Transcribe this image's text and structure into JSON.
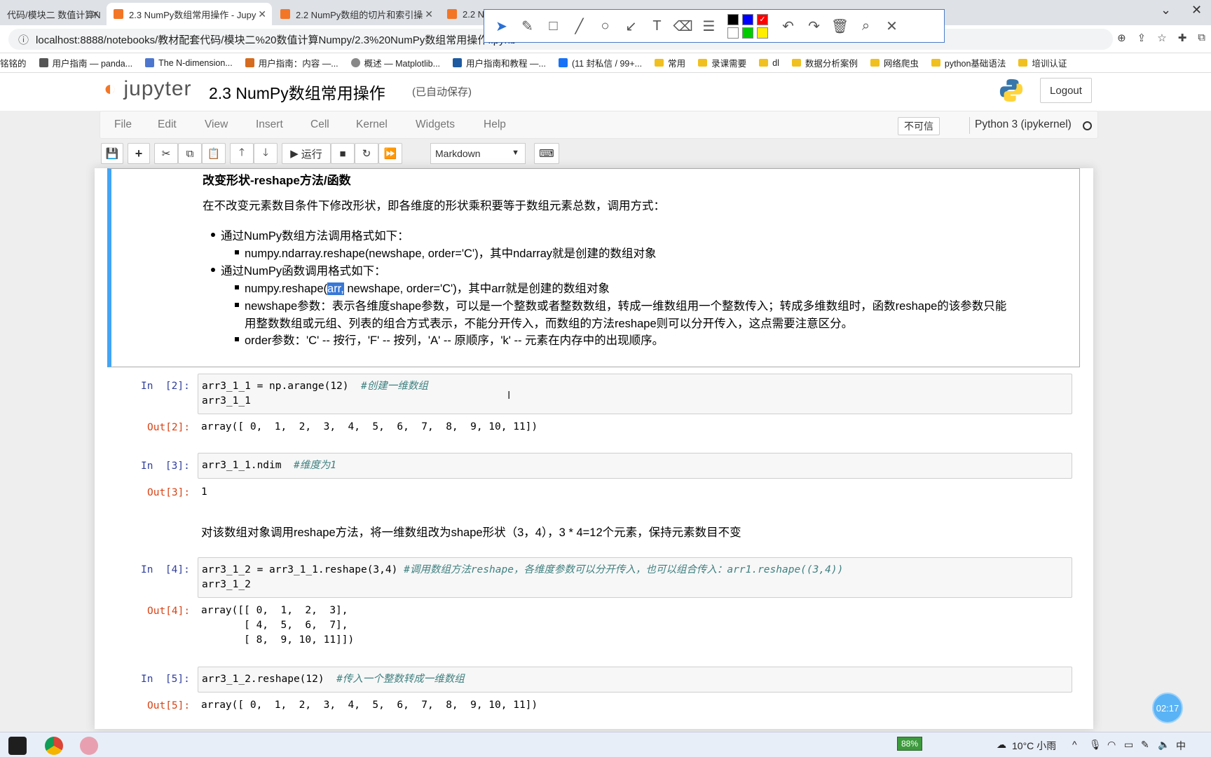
{
  "browser": {
    "tabs": [
      {
        "label": "代码/模块二 数值计算N"
      },
      {
        "label": "2.3 NumPy数组常用操作 - Jupy"
      },
      {
        "label": "2.2 NumPy数组的切片和索引操"
      },
      {
        "label": "2.2 N"
      }
    ],
    "url": "localhost:8888/notebooks/教材配套代码/模块二%20数值计算Numpy/2.3%20NumPy数组常用操作.ipynb",
    "bookmarks": [
      "铭铭的",
      "用户指南 — panda...",
      "The N-dimension...",
      "用户指南：内容 —...",
      "概述 — Matplotlib...",
      "用户指南和教程 —...",
      "(11 封私信 / 99+...",
      "常用",
      "录课需要",
      "dl",
      "数据分析案例",
      "网络爬虫",
      "python基础语法",
      "培训认证"
    ]
  },
  "draw_toolbar": {
    "tools": [
      "pointer-icon",
      "pen-icon",
      "rectangle-icon",
      "line-icon",
      "circle-icon",
      "arrow-icon",
      "text-icon",
      "eraser-icon",
      "stroke-width-icon",
      "undo-icon",
      "redo-icon",
      "trash-icon",
      "zoom-icon",
      "close-icon"
    ],
    "colors": [
      "#000000",
      "#0000ff",
      "#ff0000",
      "#ffffff",
      "#00cc00",
      "#ffee00"
    ]
  },
  "jupyter": {
    "logo_text": "jupyter",
    "notebook_title": "2.3 NumPy数组常用操作",
    "autosave": "(已自动保存)",
    "logout": "Logout",
    "menu": [
      "File",
      "Edit",
      "View",
      "Insert",
      "Cell",
      "Kernel",
      "Widgets",
      "Help"
    ],
    "trust": "不可信",
    "kernel": "Python 3 (ipykernel)",
    "run_label": "运行",
    "cell_type": "Markdown"
  },
  "markdown": {
    "heading": "改变形状-reshape方法/函数",
    "intro": "在不改变元素数目条件下修改形状，即各维度的形状乘积要等于数组元素总数，调用方式：",
    "b1": "通过NumPy数组方法调用格式如下：",
    "b1_1": "numpy.ndarray.reshape(newshape, order='C')，其中ndarray就是创建的数组对象",
    "b2": "通过NumPy函数调用格式如下：",
    "b2_1_pre": "numpy.reshape(",
    "b2_1_hl": "arr,",
    "b2_1_post": " newshape, order='C')，其中arr就是创建的数组对象",
    "b2_2_line1": "newshape参数：表示各维度shape参数，可以是一个整数或者整数数组，转成一维数组用一个整数传入；转成多维数组时，函数reshape的该参数只能",
    "b2_2_line2": "用整数数组或元组、列表的组合方式表示，不能分开传入，而数组的方法reshape则可以分开传入，这点需要注意区分。",
    "b2_3": "order参数：'C' -- 按行，'F' -- 按列，'A' -- 原顺序，'k' -- 元素在内存中的出现顺序。"
  },
  "cells": {
    "c2_in": "In  [2]:",
    "c2_l1": "arr3_1_1 = np.arange(12)",
    "c2_cm": "#创建一维数组",
    "c2_l2": "arr3_1_1",
    "c2_out_p": "Out[2]:",
    "c2_out": "array([ 0,  1,  2,  3,  4,  5,  6,  7,  8,  9, 10, 11])",
    "c3_in": "In  [3]:",
    "c3_l1": "arr3_1_1.ndim",
    "c3_cm": "#维度为1",
    "c3_out_p": "Out[3]:",
    "c3_out": "1",
    "md2": "对该数组对象调用reshape方法，将一维数组改为shape形状（3，4），3 * 4=12个元素，保持元素数目不变",
    "c4_in": "In  [4]:",
    "c4_l1": "arr3_1_2 = arr3_1_1.reshape(3,4)",
    "c4_cm": "#调用数组方法reshape，各维度参数可以分开传入，也可以组合传入：arr1.reshape((3,4))",
    "c4_l2": "arr3_1_2",
    "c4_out_p": "Out[4]:",
    "c4_out1": "array([[ 0,  1,  2,  3],",
    "c4_out2": "       [ 4,  5,  6,  7],",
    "c4_out3": "       [ 8,  9, 10, 11]])",
    "c5_in": "In  [5]:",
    "c5_l1": "arr3_1_2.reshape(12)",
    "c5_cm": "#传入一个整数转成一维数组",
    "c5_out_p": "Out[5]:",
    "c5_out": "array([ 0,  1,  2,  3,  4,  5,  6,  7,  8,  9, 10, 11])"
  },
  "taskbar": {
    "battery": "88%",
    "weather": "10°C 小雨",
    "ime": "中",
    "timer": "02:17"
  }
}
